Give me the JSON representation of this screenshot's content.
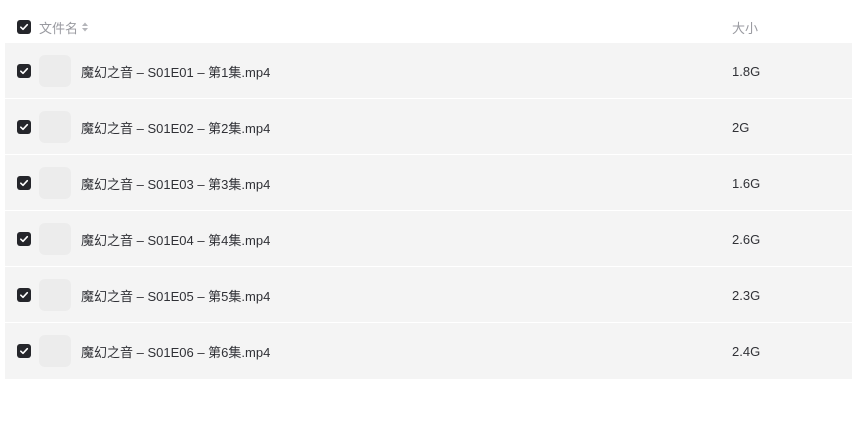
{
  "header": {
    "name_label": "文件名",
    "size_label": "大小",
    "select_all_checked": true
  },
  "files": [
    {
      "name": "魔幻之音 – S01E01 – 第1集.mp4",
      "size": "1.8G",
      "checked": true
    },
    {
      "name": "魔幻之音 – S01E02 – 第2集.mp4",
      "size": "2G",
      "checked": true
    },
    {
      "name": "魔幻之音 – S01E03 – 第3集.mp4",
      "size": "1.6G",
      "checked": true
    },
    {
      "name": "魔幻之音 – S01E04 – 第4集.mp4",
      "size": "2.6G",
      "checked": true
    },
    {
      "name": "魔幻之音 – S01E05 – 第5集.mp4",
      "size": "2.3G",
      "checked": true
    },
    {
      "name": "魔幻之音 – S01E06 – 第6集.mp4",
      "size": "2.4G",
      "checked": true
    }
  ],
  "icons": {
    "checkbox": "checkmark-icon",
    "sort": "sort-icon",
    "thumbnail": "video-thumbnail"
  },
  "colors": {
    "row_background": "#f4f4f4",
    "checkbox_fill": "#25262b",
    "header_text": "#999aa0"
  }
}
